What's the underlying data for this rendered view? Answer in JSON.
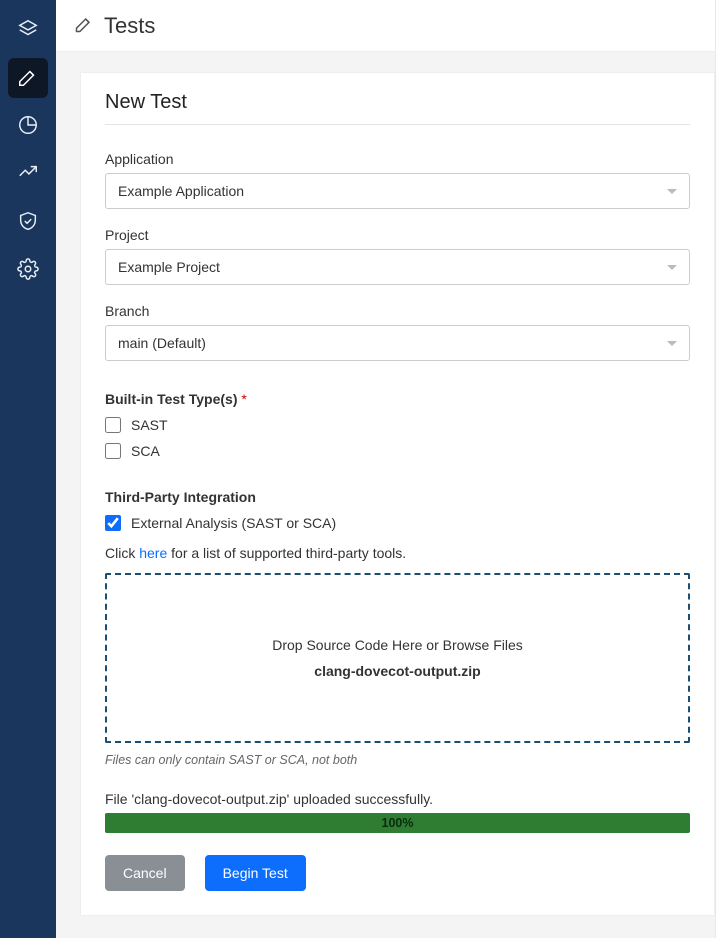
{
  "header": {
    "title": "Tests"
  },
  "card": {
    "title": "New Test"
  },
  "form": {
    "application_label": "Application",
    "application_value": "Example Application",
    "project_label": "Project",
    "project_value": "Example Project",
    "branch_label": "Branch",
    "branch_value": "main (Default)",
    "test_types_label": "Built-in Test Type(s)",
    "test_types": [
      {
        "label": "SAST",
        "checked": false
      },
      {
        "label": "SCA",
        "checked": false
      }
    ],
    "third_party_label": "Third-Party Integration",
    "third_party_option": {
      "label": "External Analysis (SAST or SCA)",
      "checked": true
    },
    "hint_prefix": "Click ",
    "hint_link": "here",
    "hint_suffix": " for a list of supported third-party tools.",
    "dropzone_primary": "Drop Source Code Here or Browse Files",
    "dropzone_file": "clang-dovecot-output.zip",
    "dropzone_hint": "Files can only contain SAST or SCA, not both",
    "upload_status": "File 'clang-dovecot-output.zip' uploaded successfully.",
    "progress_percent": "100%",
    "progress_width": "100%"
  },
  "actions": {
    "cancel": "Cancel",
    "begin": "Begin Test"
  }
}
